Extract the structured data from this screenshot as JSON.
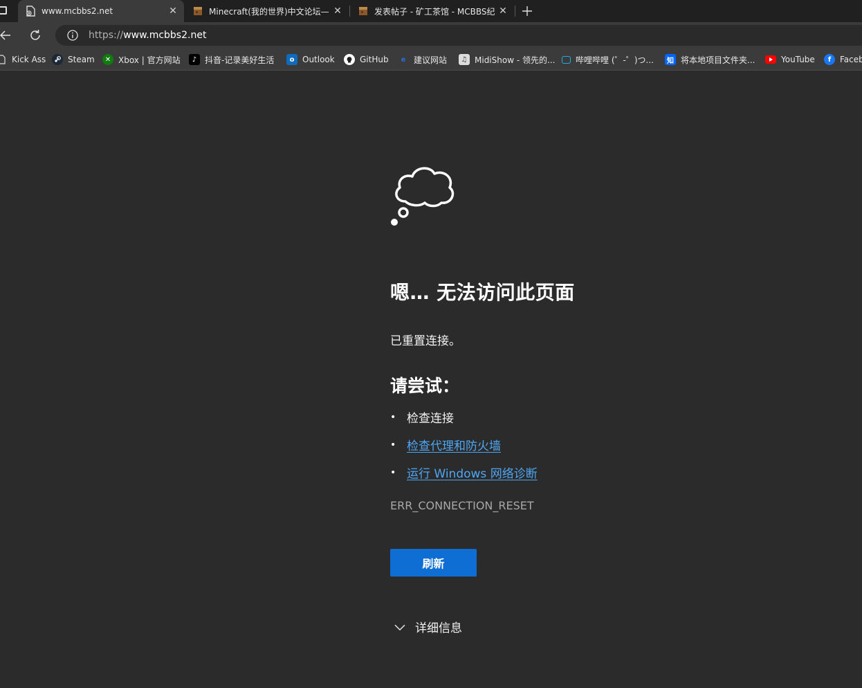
{
  "tabs": [
    {
      "title": "www.mcbbs2.net",
      "active": true,
      "favicon": "page-error-icon"
    },
    {
      "title": "Minecraft(我的世界)中文论坛—",
      "active": false,
      "favicon": "minecraft-block-icon"
    },
    {
      "title": "发表帖子 - 矿工茶馆 - MCBBS纪",
      "active": false,
      "favicon": "minecraft-block-icon"
    }
  ],
  "address_bar": {
    "scheme": "https://",
    "host": "www.mcbbs2.net"
  },
  "bookmarks": [
    {
      "label": "Kick Ass",
      "icon": "page-icon"
    },
    {
      "label": "Steam",
      "icon": "steam-icon",
      "color": "#1b2838"
    },
    {
      "label": "Xbox | 官方网站",
      "icon": "xbox-icon",
      "color": "#107c10"
    },
    {
      "label": "抖音-记录美好生活",
      "icon": "tiktok-icon",
      "color": "#000000"
    },
    {
      "label": "Outlook",
      "icon": "outlook-icon",
      "color": "#0f6cbd"
    },
    {
      "label": "GitHub",
      "icon": "github-icon",
      "color": "#ffffff"
    },
    {
      "label": "建议网站",
      "icon": "suggested-sites-icon",
      "color": "#2b6cd6"
    },
    {
      "label": "MidiShow - 领先的...",
      "icon": "midishow-icon",
      "color": "#dddddd"
    },
    {
      "label": "哔哩哔哩 (゜-゜)つ...",
      "icon": "bilibili-icon",
      "color": "#23ade5"
    },
    {
      "label": "将本地项目文件夹...",
      "icon": "zhihu-icon",
      "color": "#0066ff"
    },
    {
      "label": "YouTube",
      "icon": "youtube-icon",
      "color": "#ff0000"
    },
    {
      "label": "Faceb",
      "icon": "facebook-icon",
      "color": "#1877f2"
    }
  ],
  "error": {
    "heading": "嗯… 无法访问此页面",
    "message": "已重置连接。",
    "try_heading": "请尝试：",
    "suggestions": [
      {
        "text": "检查连接",
        "link": false
      },
      {
        "text": "检查代理和防火墙",
        "link": true
      },
      {
        "text": "运行 Windows 网络诊断",
        "link": true
      }
    ],
    "code": "ERR_CONNECTION_RESET",
    "refresh_label": "刷新",
    "details_label": "详细信息"
  },
  "colors": {
    "background": "#2b2b2b",
    "link": "#4ea7f5",
    "button": "#0f6ed4"
  }
}
